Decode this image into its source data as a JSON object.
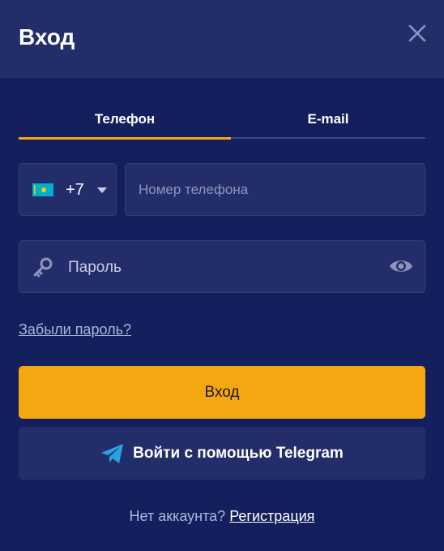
{
  "dialog": {
    "title": "Вход"
  },
  "tabs": [
    {
      "label": "Телефон",
      "active": true
    },
    {
      "label": "E-mail",
      "active": false
    }
  ],
  "phone": {
    "country_flag": "kazakhstan-flag-icon",
    "dial_code": "+7",
    "placeholder": "Номер телефона",
    "value": ""
  },
  "password": {
    "placeholder": "Пароль",
    "value": ""
  },
  "links": {
    "forgot_password": "Забыли пароль?"
  },
  "buttons": {
    "submit": "Вход",
    "telegram": "Войти с помощью Telegram"
  },
  "footer": {
    "prompt": "Нет аккаунта?",
    "register": "Регистрация"
  },
  "colors": {
    "background": "#141f5e",
    "header": "#232d6a",
    "accent": "#f5a712",
    "telegram_blue": "#2aa3de"
  }
}
